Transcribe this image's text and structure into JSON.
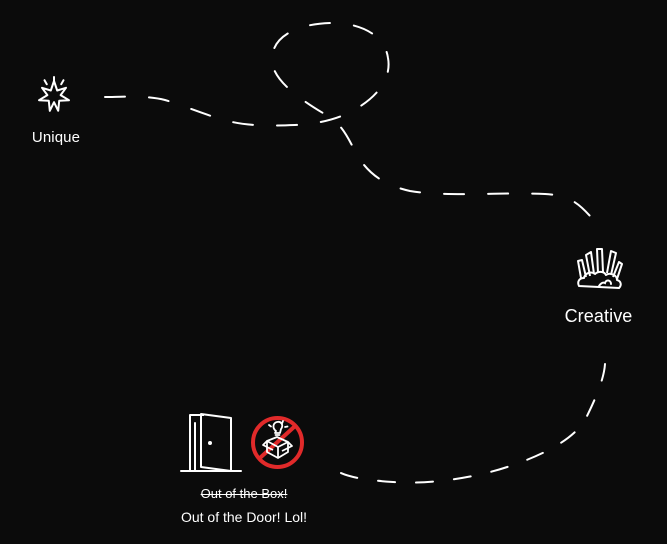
{
  "labels": {
    "unique": "Unique",
    "creative": "Creative",
    "out_of_box": "Out of the Box!",
    "out_of_door": "Out of the Door! Lol!"
  },
  "icons": {
    "unique": "sparkle-icon",
    "creative": "art-supplies-icon",
    "door": "door-icon",
    "no_box": "no-box-icon"
  },
  "colors": {
    "background": "#0b0b0b",
    "foreground": "#ffffff",
    "accent_red": "#e12a2a"
  }
}
